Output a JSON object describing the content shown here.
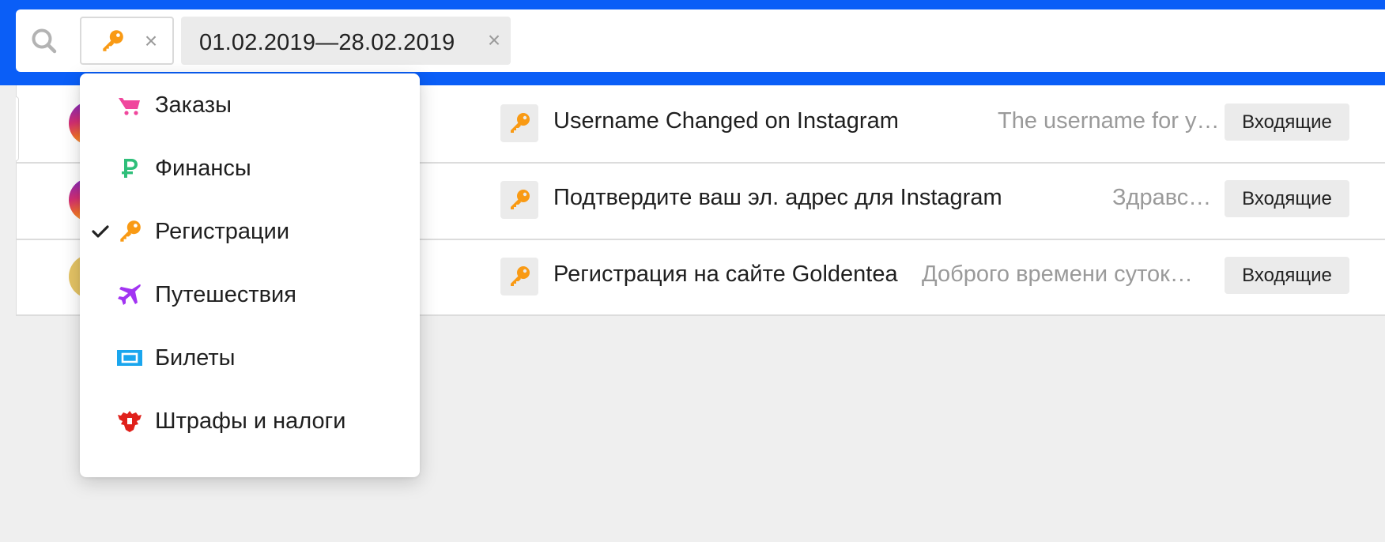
{
  "search": {
    "category_chip": {
      "icon": "key-icon",
      "close": "×"
    },
    "date_chip": {
      "label": "01.02.2019—28.02.2019",
      "close": "×"
    }
  },
  "messages": [
    {
      "avatar": "instagram",
      "category_icon": "key-icon",
      "subject": "Username Changed on Instagram",
      "snippet": "The username for y…",
      "folder": "Входящие"
    },
    {
      "avatar": "instagram",
      "category_icon": "key-icon",
      "subject": "Подтвердите ваш эл. адрес для Instagram",
      "snippet": "Здравс…",
      "folder": "Входящие"
    },
    {
      "avatar": "goldentea",
      "category_icon": "key-icon",
      "subject": "Регистрация на сайте Goldentea",
      "snippet": "Доброго времени суток…",
      "folder": "Входящие"
    }
  ],
  "category_menu": {
    "items": [
      {
        "label": "Заказы",
        "icon": "cart-icon",
        "color": "#f0479d",
        "checked": false
      },
      {
        "label": "Финансы",
        "icon": "ruble-icon",
        "color": "#2fbf7a",
        "checked": false
      },
      {
        "label": "Регистрации",
        "icon": "key-icon",
        "color": "#f99a14",
        "checked": true
      },
      {
        "label": "Путешествия",
        "icon": "airplane-icon",
        "color": "#a234f2",
        "checked": false
      },
      {
        "label": "Билеты",
        "icon": "ticket-icon",
        "color": "#1aa6ee",
        "checked": false
      },
      {
        "label": "Штрафы и налоги",
        "icon": "eagle-emblem-icon",
        "color": "#e0211b",
        "checked": false
      }
    ]
  },
  "colors": {
    "header": "#0a5ef7",
    "key": "#f99a14",
    "muted_text": "#9a9a9a"
  }
}
